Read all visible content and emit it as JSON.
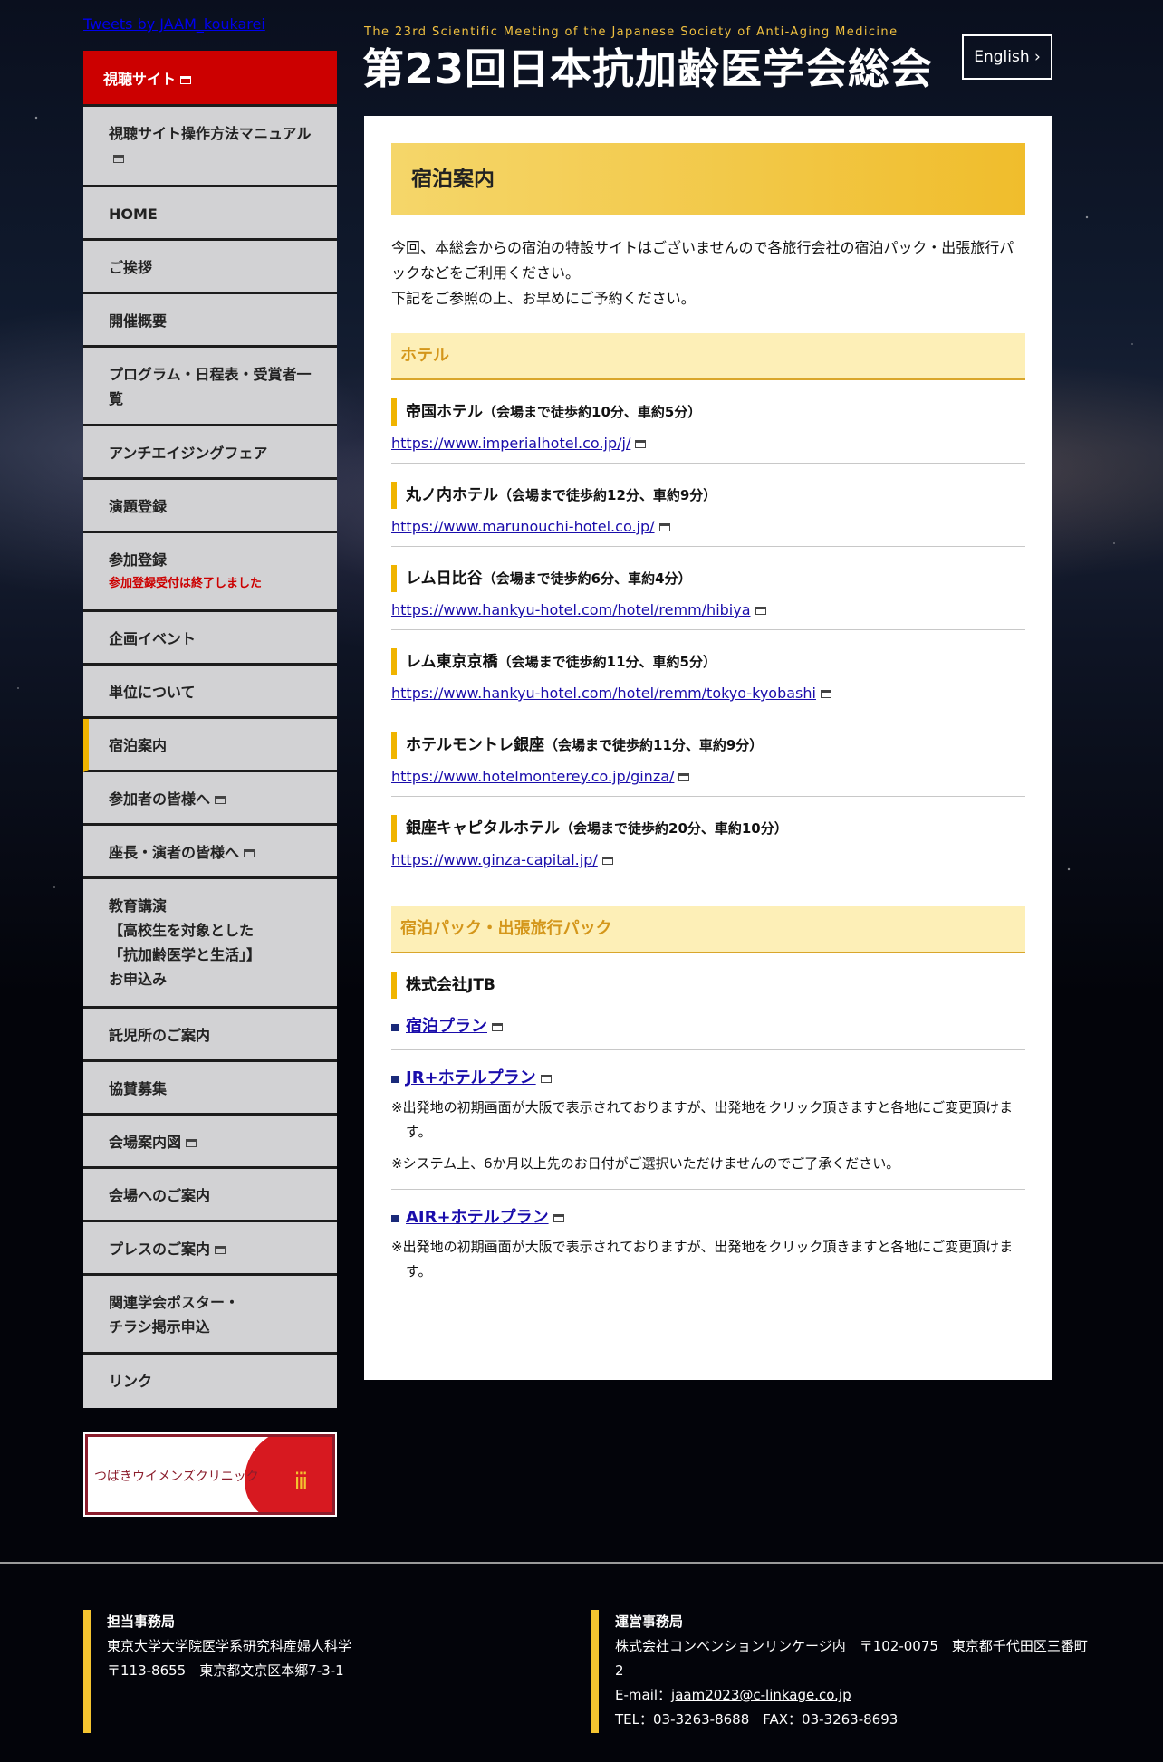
{
  "tweets_link": "Tweets by JAAM_koukarei",
  "header": {
    "subtitle": "The 23rd Scientific Meeting of the Japanese Society of Anti-Aging Medicine",
    "title": "第23回日本抗加齢医学会総会",
    "english_button": "English ›"
  },
  "sidebar": {
    "top_item": "視聴サイト",
    "items": [
      {
        "label": "視聴サイト操作方法マニュアル"
      },
      {
        "label": "HOME"
      },
      {
        "label": "ご挨拶"
      },
      {
        "label": "開催概要"
      },
      {
        "label": "プログラム・日程表・受賞者一覧"
      },
      {
        "label": "アンチエイジングフェア"
      },
      {
        "label": "演題登録"
      },
      {
        "label": "参加登録",
        "note": "参加登録受付は終了しました"
      },
      {
        "label": "企画イベント"
      },
      {
        "label": "単位について"
      },
      {
        "label": "宿泊案内"
      },
      {
        "label": "参加者の皆様へ"
      },
      {
        "label": "座長・演者の皆様へ"
      },
      {
        "label": "教育講演\n【高校生を対象とした\n「抗加齢医学と生活」】\nお申込み"
      },
      {
        "label": "託児所のご案内"
      },
      {
        "label": "協賛募集"
      },
      {
        "label": "会場案内図"
      },
      {
        "label": "会場へのご案内"
      },
      {
        "label": "プレスのご案内"
      },
      {
        "label": "関連学会ポスター・\nチラシ掲示申込"
      },
      {
        "label": "リンク"
      }
    ],
    "banner_text": "つばきウイメンズクリニック"
  },
  "main": {
    "title": "宿泊案内",
    "intro_1": "今回、本総会からの宿泊の特設サイトはございませんので各旅行会社の宿泊パック・出張旅行パックなどをご利用ください。",
    "intro_2": "下記をご参照の上、お早めにご予約ください。",
    "hotel_section": "ホテル",
    "hotels": [
      {
        "name": "帝国ホテル",
        "access": "（会場まで徒歩約10分、車約5分）",
        "url": "https://www.imperialhotel.co.jp/j/"
      },
      {
        "name": "丸ノ内ホテル",
        "access": "（会場まで徒歩約12分、車約9分）",
        "url": "https://www.marunouchi-hotel.co.jp/"
      },
      {
        "name": "レム日比谷",
        "access": "（会場まで徒歩約6分、車約4分）",
        "url": "https://www.hankyu-hotel.com/hotel/remm/hibiya"
      },
      {
        "name": "レム東京京橋",
        "access": "（会場まで徒歩約11分、車約5分）",
        "url": "https://www.hankyu-hotel.com/hotel/remm/tokyo-kyobashi"
      },
      {
        "name": "ホテルモントレ銀座",
        "access": "（会場まで徒歩約11分、車約9分）",
        "url": "https://www.hotelmonterey.co.jp/ginza/"
      },
      {
        "name": "銀座キャピタルホテル",
        "access": "（会場まで徒歩約20分、車約10分）",
        "url": "https://www.ginza-capital.jp/"
      }
    ],
    "pack_section": "宿泊パック・出張旅行パック",
    "company": "株式会社JTB",
    "plans": {
      "p1": "宿泊プラン",
      "p2": "JR+ホテルプラン",
      "p2_note1": "※出発地の初期画面が大阪で表示されておりますが、出発地をクリック頂きますと各地にご変更頂けます。",
      "p2_note2": "※システム上、6か月以上先のお日付がご選択いただけませんのでご了承ください。",
      "p3": "AIR+ホテルプラン",
      "p3_note1": "※出発地の初期画面が大阪で表示されておりますが、出発地をクリック頂きますと各地にご変更頂けます。"
    }
  },
  "footer": {
    "left": {
      "heading": "担当事務局",
      "line1": "東京大学大学院医学系研究科産婦人科学",
      "line2": "〒113-8655　東京都文京区本郷7-3-1"
    },
    "right": {
      "heading": "運営事務局",
      "line1": "株式会社コンベンションリンケージ内　〒102-0075　東京都千代田区三番町2",
      "email_label": "E-mail：",
      "email": "jaam2023@c-linkage.co.jp",
      "tel": "TEL：03-3263-8688　FAX：03-3263-8693"
    }
  }
}
